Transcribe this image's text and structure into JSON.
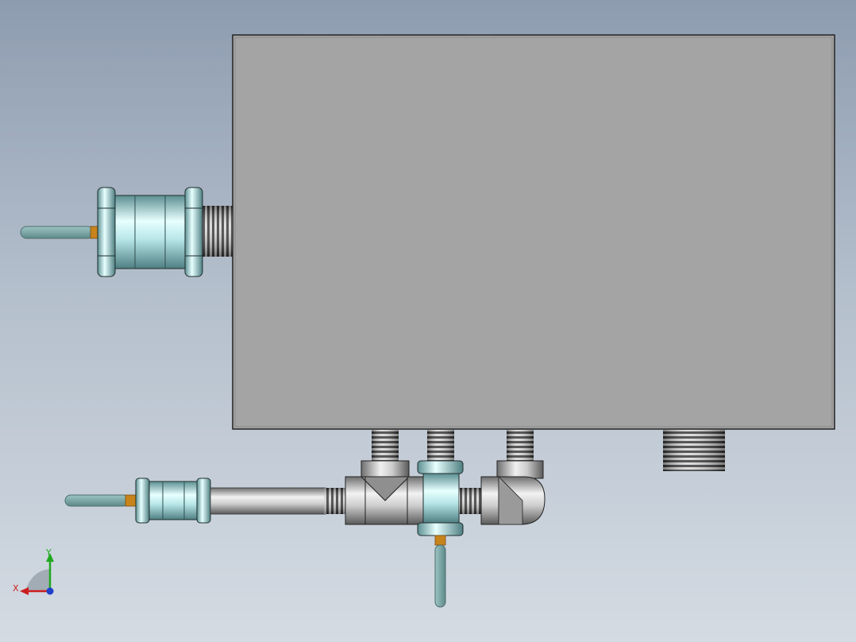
{
  "viewport": {
    "title": "",
    "background_top": "#8e9cb0",
    "background_bottom": "#d4dbe3"
  },
  "model": {
    "enclosure_color": "#a4a4a4",
    "fitting_color": "#c8eef0",
    "pipe_color": "#b8b8b8",
    "rod_color": "#7ea6a6",
    "accent_color": "#c8841c",
    "parts": [
      "enclosure-box",
      "left-union-fitting",
      "bottom-pipe-assembly",
      "tee-fitting",
      "elbow-fitting",
      "threaded-nipples",
      "drain-rod"
    ]
  },
  "triad": {
    "x_label": "X",
    "y_label": "Y",
    "x_color": "#cc1f1f",
    "y_color": "#1fa81f",
    "z_color": "#1f3fcc"
  }
}
